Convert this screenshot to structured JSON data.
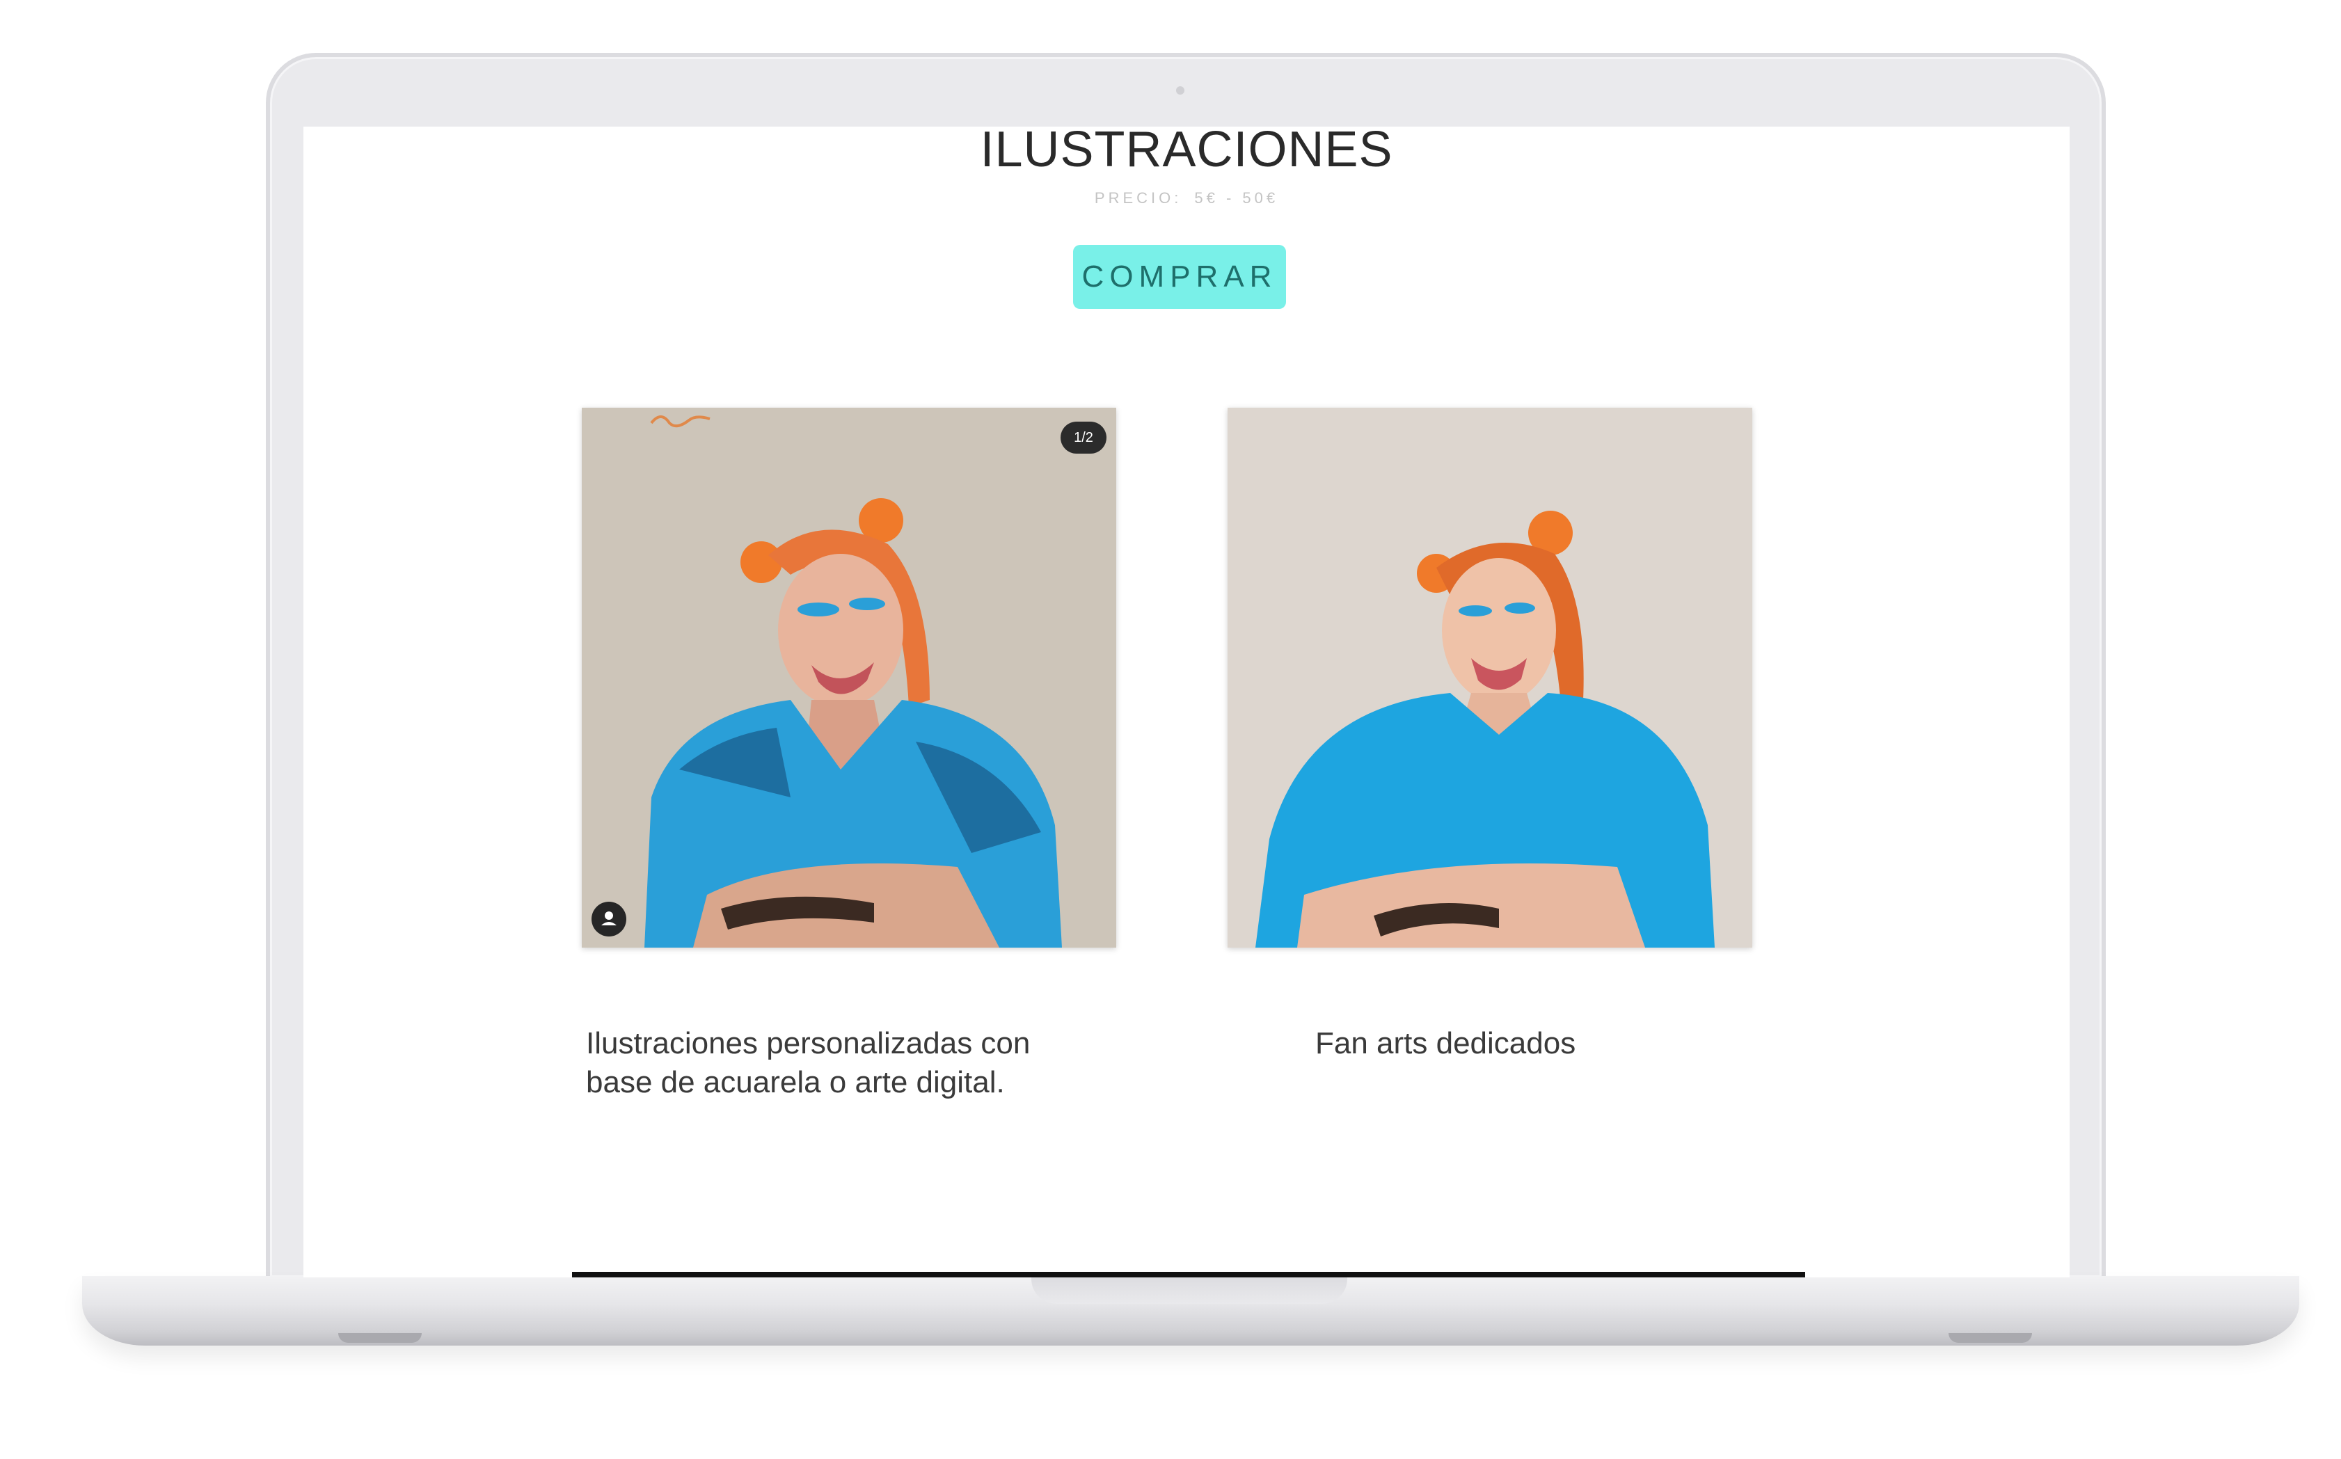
{
  "section": {
    "title": "ILUSTRACIONES",
    "price_label": "PRECIO:",
    "price_value": "5€ - 50€",
    "buy_label": "COMPRAR"
  },
  "cards": [
    {
      "counter": "1/2",
      "caption_line1": "Ilustraciones personalizadas con",
      "caption_line2": "base de acuarela o arte digital.",
      "image": "illustrated-portrait-woman-blue-sweater"
    },
    {
      "caption": "Fan arts dedicados",
      "image": "photo-woman-blue-sweater"
    }
  ],
  "colors": {
    "accent": "#79f0e8",
    "sweater_blue": "#2a9fd8",
    "hair_orange": "#f07a2a"
  }
}
